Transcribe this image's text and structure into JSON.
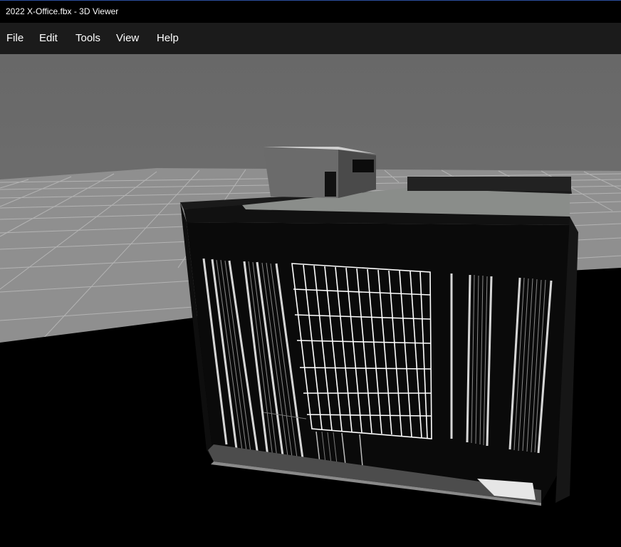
{
  "window": {
    "title": "2022 X-Office.fbx - 3D Viewer"
  },
  "menu": {
    "items": [
      {
        "label": "File"
      },
      {
        "label": "Edit"
      },
      {
        "label": "Tools"
      },
      {
        "label": "View"
      },
      {
        "label": "Help"
      }
    ]
  },
  "viewport": {
    "model": "office-building",
    "background_color": "#6f6f6f",
    "ground_color": "#000000",
    "grid_color": "#a8a8a8"
  }
}
